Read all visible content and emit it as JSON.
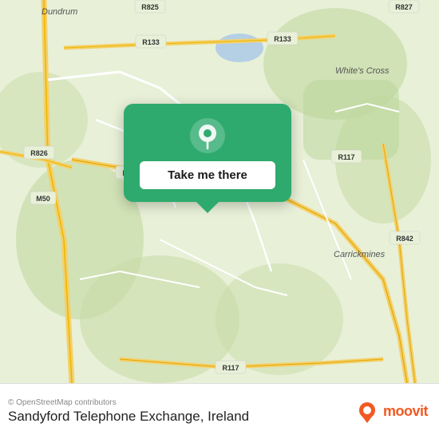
{
  "map": {
    "alt": "Map of Sandyford area, Ireland",
    "center_lat": 53.27,
    "center_lon": -6.22
  },
  "popup": {
    "button_label": "Take me there"
  },
  "bottom_bar": {
    "attribution": "© OpenStreetMap contributors",
    "location_name": "Sandyford Telephone Exchange, Ireland",
    "moovit_label": "moovit"
  }
}
